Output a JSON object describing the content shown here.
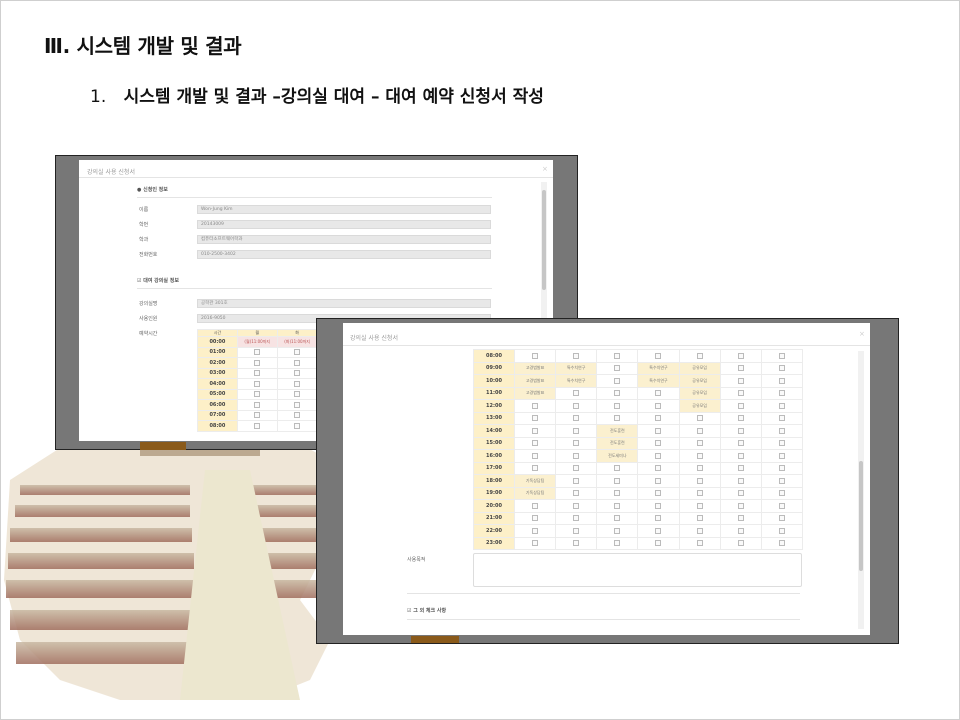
{
  "slide": {
    "title": "Ⅲ. 시스템 개발 및 결과",
    "subtitle_number": "1.",
    "subtitle_text": "시스템 개발 및 결과 –강의실 대여 – 대여 예약 신청서 작성"
  },
  "modal": {
    "title": "강의실 사용 신청서",
    "close": "×",
    "applicant_section": "신청인 정보",
    "rental_section": "대여 강의실 정보",
    "extra_section": "그 외 체크 사항",
    "fields": [
      {
        "label": "이름",
        "value": "Won-Jung Kim"
      },
      {
        "label": "학번",
        "value": "20143009"
      },
      {
        "label": "학과",
        "value": "컴퓨터소프트웨어학과"
      },
      {
        "label": "전화번호",
        "value": "010-2500-3402"
      }
    ],
    "rental_fields": [
      {
        "label": "강의실명",
        "value": "공학관 301호"
      },
      {
        "label": "사용인원",
        "value": "2016-9050"
      }
    ],
    "reserve_time_label": "예약시간",
    "purpose_label": "사용목적"
  },
  "timetable_front": {
    "times": [
      "00:00",
      "01:00",
      "02:00",
      "03:00",
      "04:00",
      "05:00",
      "06:00",
      "07:00",
      "08:00"
    ],
    "header_corner": "시간",
    "days": [
      "월",
      "화",
      "수",
      "목",
      "금"
    ],
    "booked_row": [
      "(월)11:00까지",
      "(화)11:00까지"
    ]
  },
  "timetable_back": {
    "times": [
      "08:00",
      "09:00",
      "10:00",
      "11:00",
      "12:00",
      "13:00",
      "14:00",
      "15:00",
      "16:00",
      "17:00",
      "18:00",
      "19:00",
      "20:00",
      "21:00",
      "22:00",
      "23:00"
    ],
    "bookings": [
      {
        "row": 1,
        "col": 0,
        "text": "고경범발표"
      },
      {
        "row": 1,
        "col": 1,
        "text": "특수치연구"
      },
      {
        "row": 1,
        "col": 3,
        "text": "특수치연구"
      },
      {
        "row": 1,
        "col": 4,
        "text": "공유모임"
      },
      {
        "row": 2,
        "col": 0,
        "text": "고경범발표"
      },
      {
        "row": 2,
        "col": 1,
        "text": "특수치연구"
      },
      {
        "row": 2,
        "col": 3,
        "text": "특수치연구"
      },
      {
        "row": 2,
        "col": 4,
        "text": "공유모임"
      },
      {
        "row": 3,
        "col": 0,
        "text": "고경범발표"
      },
      {
        "row": 3,
        "col": 4,
        "text": "공유모임"
      },
      {
        "row": 4,
        "col": 4,
        "text": "공유모임"
      },
      {
        "row": 6,
        "col": 2,
        "text": "전도훈련"
      },
      {
        "row": 7,
        "col": 2,
        "text": "전도훈련"
      },
      {
        "row": 8,
        "col": 2,
        "text": "전도세미나"
      },
      {
        "row": 10,
        "col": 0,
        "text": "기독상담팀"
      },
      {
        "row": 11,
        "col": 0,
        "text": "기독상담팀"
      }
    ]
  }
}
